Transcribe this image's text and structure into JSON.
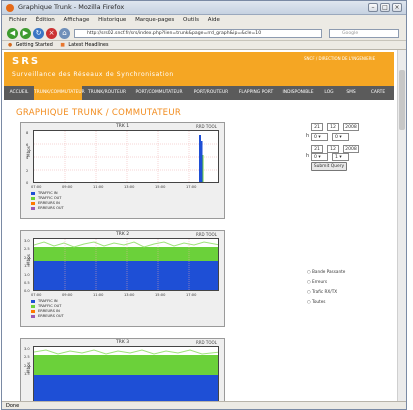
{
  "browser": {
    "title": "Graphique Trunk - Mozilla Firefox",
    "menu": [
      "Fichier",
      "Édition",
      "Affichage",
      "Historique",
      "Marque-pages",
      "Outils",
      "Aide"
    ],
    "url": "http://srs02.sncf.fr/srs/index.php?lien=trunk&page=rrd_graph&ip=&cle=10",
    "search_placeholder": "Google",
    "bookmarks": [
      "Getting Started",
      "Latest Headlines"
    ],
    "status": "Done"
  },
  "header": {
    "brand": "SRS",
    "subtitle": "Surveillance des Réseaux de Synchronisation",
    "right": "SNCF / DIRECTION DE L'INGENIERIE"
  },
  "tabs": [
    "ACCUEIL",
    "TRUNK/COMMUTATEUR",
    "TRUNK/ROUTEUR",
    "PORT/COMMUTATEUR",
    "PORT/ROUTEUR",
    "FLAPPING PORT",
    "INDISPONIBLE",
    "LOG",
    "SMS",
    "CARTE"
  ],
  "page_title": "GRAPHIQUE TRUNK / COMMUTATEUR",
  "charts": [
    {
      "title": "TRK 1",
      "tool": "RRD TOOL",
      "ylabel": "Mbps",
      "yticks": [
        "8",
        "6",
        "4",
        "2",
        "0"
      ],
      "xticks": [
        "07:00",
        "09:00",
        "11:00",
        "13:00",
        "15:00",
        "17:00"
      ],
      "legend": [
        {
          "name": "TRAFFIC IN",
          "color": "#1e4fd6"
        },
        {
          "name": "TRAFFIC OUT",
          "color": "#6bd13a"
        },
        {
          "name": "ERREURS IN",
          "color": "#ff7a00"
        },
        {
          "name": "ERREURS OUT",
          "color": "#9b59b6"
        }
      ]
    },
    {
      "title": "TRK 2",
      "tool": "RRD TOOL",
      "ylabel": "Mbps",
      "yticks": [
        "3.0",
        "2.5",
        "2.0",
        "1.5",
        "1.0",
        "0.5",
        "0.0"
      ],
      "xticks": [
        "07:00",
        "09:00",
        "11:00",
        "13:00",
        "15:00",
        "17:00"
      ],
      "legend": [
        {
          "name": "TRAFFIC IN",
          "color": "#1e4fd6"
        },
        {
          "name": "TRAFFIC OUT",
          "color": "#6bd13a"
        },
        {
          "name": "ERREURS IN",
          "color": "#ff7a00"
        },
        {
          "name": "ERREURS OUT",
          "color": "#9b59b6"
        }
      ]
    },
    {
      "title": "TRK 3",
      "tool": "RRD TOOL",
      "ylabel": "Mbps",
      "yticks": [
        "3.0",
        "2.5",
        "2.0",
        "1.5"
      ],
      "xticks": [],
      "legend": []
    }
  ],
  "form": {
    "start": {
      "day": "21",
      "month": "12",
      "year": "2008",
      "hour": "0",
      "minute": "0"
    },
    "end": {
      "day": "21",
      "month": "12",
      "year": "2008",
      "hour": "0",
      "minute": "1"
    },
    "submit_label": "Submit Query"
  },
  "options": [
    "Bande Passante",
    "Erreurs",
    "Trafic RX/TX",
    "Toutes"
  ]
}
